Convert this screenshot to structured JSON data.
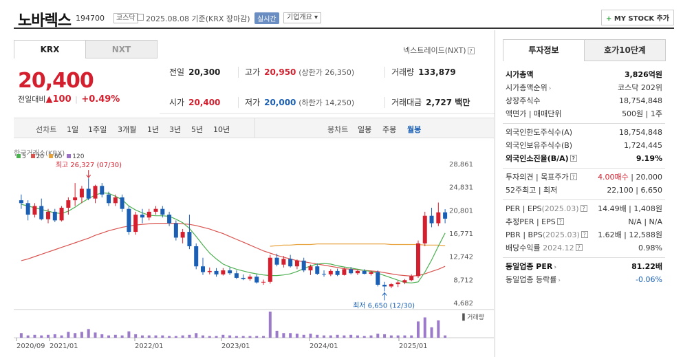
{
  "header": {
    "name": "노바렉스",
    "code": "194700",
    "market_badge": "코스닥",
    "date_text": "2025.08.08",
    "basis_text": "기준(KRX 장마감)",
    "realtime_label": "실시간",
    "company_info_label": "기업개요",
    "mystock_label": "MY STOCK 추가"
  },
  "market_tabs": [
    "KRX",
    "NXT"
  ],
  "nxt_link": "넥스트레이드(NXT)",
  "price": {
    "current": "20,400",
    "change_label": "전일대비",
    "change_value": "100",
    "change_pct": "+0.49%",
    "colors": {
      "up": "#d4202e",
      "down": "#1a5fb4"
    }
  },
  "stats": {
    "prev_label": "전일",
    "prev": "20,300",
    "high_label": "고가",
    "high": "20,950",
    "upper_limit": "(상한가 26,350)",
    "volume_label": "거래량",
    "volume": "133,879",
    "open_label": "시가",
    "open": "20,400",
    "low_label": "저가",
    "low": "20,000",
    "lower_limit": "(하한가 14,250)",
    "amount_label": "거래대금",
    "amount": "2,727 백만"
  },
  "chart_toolbar": {
    "line_label": "선차트",
    "line_periods": [
      "1일",
      "1주일",
      "3개월",
      "1년",
      "3년",
      "5년",
      "10년"
    ],
    "candle_label": "봉차트",
    "candle_periods": [
      "일봉",
      "주봉",
      "월봉"
    ],
    "active_candle": "월봉"
  },
  "chart_legend": {
    "title": "한국거래소(KRX)",
    "ma": [
      {
        "label": "5",
        "color": "#4caf50"
      },
      {
        "label": "20",
        "color": "#d9534f"
      },
      {
        "label": "60",
        "color": "#e8a23b"
      },
      {
        "label": "120",
        "color": "#9b6fc7"
      }
    ]
  },
  "chart_data": {
    "type": "candlestick",
    "y_ticks": [
      "28,861",
      "24,831",
      "20,801",
      "16,771",
      "12,742",
      "8,712",
      "4,682"
    ],
    "ylim": [
      4682,
      28861
    ],
    "x_ticks": [
      "2020/09",
      "2021/01",
      "2022/01",
      "2023/01",
      "2024/01",
      "2025/01"
    ],
    "max_annotation": "최고 26,327 (07/30)",
    "min_annotation": "최저 6,650 (12/30)",
    "volume_label": "거래량",
    "candles": [
      [
        22500,
        23500,
        21000,
        22000
      ],
      [
        22000,
        22500,
        19000,
        20000
      ],
      [
        20000,
        22000,
        19500,
        21500
      ],
      [
        21500,
        22800,
        19000,
        19200
      ],
      [
        19200,
        21000,
        18500,
        20500
      ],
      [
        20500,
        21000,
        18700,
        19000
      ],
      [
        19000,
        21500,
        18800,
        21200
      ],
      [
        21200,
        23000,
        20000,
        22500
      ],
      [
        22500,
        25500,
        21500,
        23000
      ],
      [
        23000,
        25000,
        22000,
        24500
      ],
      [
        24500,
        26327,
        22500,
        22800
      ],
      [
        22800,
        25200,
        22000,
        25000
      ],
      [
        25000,
        25500,
        23000,
        23500
      ],
      [
        23500,
        24000,
        21500,
        22000
      ],
      [
        22000,
        23500,
        21500,
        23000
      ],
      [
        23000,
        23500,
        20500,
        21000
      ],
      [
        21000,
        21500,
        16500,
        17000
      ],
      [
        17000,
        20500,
        16500,
        20000
      ],
      [
        20000,
        21000,
        18500,
        19500
      ],
      [
        19500,
        21000,
        19000,
        20500
      ],
      [
        20500,
        21500,
        20000,
        21000
      ],
      [
        21000,
        21500,
        19500,
        20000
      ],
      [
        20000,
        20500,
        18000,
        18500
      ],
      [
        18500,
        19000,
        15500,
        16000
      ],
      [
        16000,
        17500,
        15000,
        17000
      ],
      [
        17000,
        20000,
        14000,
        14500
      ],
      [
        14500,
        15000,
        10500,
        11000
      ],
      [
        11000,
        12500,
        9500,
        10000
      ],
      [
        10000,
        10800,
        9600,
        10200
      ],
      [
        10200,
        10700,
        9200,
        9600
      ],
      [
        9600,
        10700,
        9400,
        10300
      ],
      [
        10300,
        10800,
        9500,
        9800
      ],
      [
        9800,
        10300,
        8800,
        9000
      ],
      [
        9000,
        9600,
        8600,
        8800
      ],
      [
        8800,
        9600,
        8500,
        9200
      ],
      [
        9200,
        9600,
        8000,
        8200
      ],
      [
        8200,
        8700,
        7800,
        8300
      ],
      [
        8300,
        13000,
        8000,
        12500
      ],
      [
        12500,
        13200,
        11000,
        11300
      ],
      [
        11300,
        12800,
        10800,
        12300
      ],
      [
        12300,
        13000,
        10800,
        11000
      ],
      [
        11000,
        12200,
        10500,
        12000
      ],
      [
        12000,
        12500,
        10000,
        10300
      ],
      [
        10300,
        11300,
        9500,
        11000
      ],
      [
        11000,
        11500,
        9500,
        9700
      ],
      [
        9700,
        10300,
        9200,
        9600
      ],
      [
        9600,
        10500,
        9300,
        10200
      ],
      [
        10200,
        10600,
        9300,
        9500
      ],
      [
        9500,
        10800,
        9400,
        10500
      ],
      [
        10500,
        10900,
        9600,
        9800
      ],
      [
        9800,
        10400,
        9500,
        10200
      ],
      [
        10200,
        10500,
        9600,
        9700
      ],
      [
        9700,
        10200,
        9400,
        10000
      ],
      [
        10000,
        10300,
        7500,
        7800
      ],
      [
        7800,
        8300,
        6650,
        7500
      ],
      [
        7500,
        8100,
        7200,
        7900
      ],
      [
        7900,
        8500,
        7400,
        8200
      ],
      [
        8200,
        8800,
        7900,
        8600
      ],
      [
        8600,
        9600,
        8400,
        9300
      ],
      [
        9300,
        15500,
        9000,
        15000
      ],
      [
        15000,
        20500,
        14500,
        19800
      ],
      [
        19800,
        21200,
        17800,
        18500
      ],
      [
        18500,
        22100,
        18000,
        20400
      ],
      [
        20400,
        20950,
        18500,
        19300
      ]
    ],
    "ma5": [
      21800,
      21500,
      21200,
      20900,
      20600,
      20300,
      20200,
      20600,
      21300,
      22100,
      22800,
      23400,
      23800,
      23700,
      23200,
      22600,
      21500,
      20800,
      20300,
      19900,
      19800,
      19800,
      19700,
      19200,
      18600,
      17600,
      16200,
      14700,
      13300,
      12300,
      11400,
      10900,
      10500,
      10200,
      9900,
      9700,
      9500,
      9400,
      9400,
      9500,
      9700,
      10100,
      10600,
      11100,
      11400,
      11500,
      11400,
      11100,
      10900,
      10700,
      10500,
      10300,
      10100,
      9800,
      9400,
      9000,
      8600,
      8200,
      8100,
      8300,
      10000,
      12100,
      14500,
      16800
    ],
    "ma20": [
      12000,
      12300,
      12700,
      13100,
      13500,
      13900,
      14300,
      14700,
      15100,
      15500,
      15900,
      16400,
      16800,
      17200,
      17500,
      17800,
      18000,
      18200,
      18300,
      18400,
      18500,
      18500,
      18500,
      18500,
      18400,
      18300,
      18100,
      17800,
      17500,
      17100,
      16700,
      16200,
      15700,
      15200,
      14700,
      14200,
      13700,
      13300,
      12900,
      12600,
      12300,
      12000,
      11800,
      11600,
      11400,
      11200,
      11000,
      10800,
      10600,
      10500,
      10400,
      10300,
      10200,
      10100,
      9900,
      9700,
      9500,
      9400,
      9300,
      9400,
      9700,
      10100,
      10500,
      11000
    ],
    "ma60_start_index": 37,
    "ma60": [
      14500,
      14600,
      14700,
      14700,
      14800,
      14800,
      14800,
      14900,
      14900,
      14900,
      14900,
      14900,
      14900,
      14900,
      14900,
      14900,
      14900,
      14900,
      14800,
      14800,
      14800,
      14800,
      14800,
      14700,
      14700,
      14700,
      14600
    ],
    "volume": [
      8,
      4,
      5,
      4,
      5,
      6,
      4,
      10,
      8,
      10,
      15,
      9,
      6,
      4,
      5,
      4,
      11,
      6,
      4,
      4,
      4,
      4,
      3,
      3,
      4,
      5,
      8,
      4,
      3,
      3,
      5,
      4,
      3,
      3,
      3,
      3,
      3,
      45,
      12,
      8,
      8,
      7,
      5,
      7,
      5,
      4,
      4,
      5,
      4,
      5,
      4,
      3,
      4,
      7,
      6,
      4,
      4,
      4,
      4,
      28,
      35,
      18,
      30,
      4
    ]
  },
  "right_tabs": [
    "투자정보",
    "호가10단계"
  ],
  "invest": {
    "s1": [
      {
        "l": "시가총액",
        "r": "3,826억원",
        "bold": true
      },
      {
        "l": "시가총액순위",
        "r": "코스닥 202위",
        "arrow": true
      },
      {
        "l": "상장주식수",
        "r": "18,754,848"
      },
      {
        "l": "액면가 | 매매단위",
        "r": "500원 | 1주"
      }
    ],
    "s2": [
      {
        "l": "외국인한도주식수(A)",
        "r": "18,754,848"
      },
      {
        "l": "외국인보유주식수(B)",
        "r": "1,724,445"
      },
      {
        "l": "외국인소진율(B/A)",
        "r": "9.19%",
        "bold": true,
        "q": true
      }
    ],
    "s3": [
      {
        "l": "투자의견 | 목표주가",
        "r_red": "4.00매수",
        "r": " | 20,000",
        "q": true
      },
      {
        "l": "52주최고 | 최저",
        "r": "22,100 | 6,650"
      }
    ],
    "s4": [
      {
        "l": "PER | EPS",
        "gr": "(2025.03)",
        "r": "14.49배 | 1,408원",
        "q": true
      },
      {
        "l": "추정PER | EPS",
        "r": "N/A | N/A",
        "q": true
      },
      {
        "l": "PBR | BPS",
        "gr": "(2025.03)",
        "r": "1.62배 | 12,588원",
        "q": true
      },
      {
        "l": "배당수익률",
        "gr": "2024.12",
        "r": "0.98%",
        "q": true
      }
    ],
    "s5": [
      {
        "l": "동일업종 PER",
        "r": "81.22배",
        "bold": true,
        "arrow": true
      },
      {
        "l": "동일업종 등락률",
        "r_blue": "-0.06%",
        "arrow": true
      }
    ]
  }
}
